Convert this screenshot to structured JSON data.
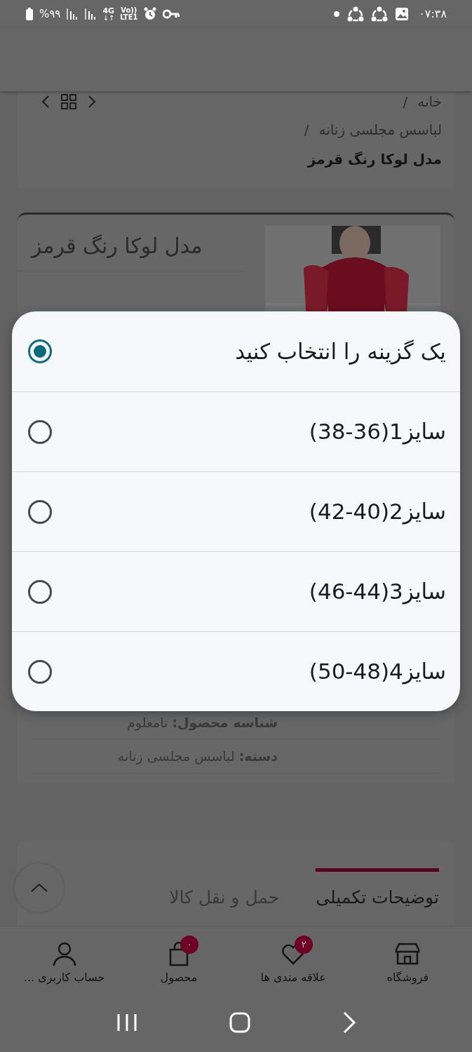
{
  "status_bar": {
    "time": "۰۷:۳۸",
    "battery": "%۹۹",
    "network": "4G",
    "data_arrows": "↓↑",
    "volte": "Vo))",
    "lte": "LTE1"
  },
  "breadcrumb": {
    "items": [
      "خانه",
      "لباسس مجلسی زنانه"
    ],
    "separators": [
      "/",
      "/"
    ],
    "current": "مدل لوکا رنگ قرمز"
  },
  "product": {
    "title": "مدل لوکا رنگ قرمز"
  },
  "dialog": {
    "options": [
      {
        "label": "یک گزینه را انتخاب کنید",
        "selected": true
      },
      {
        "label": "سایز1(36-38)",
        "selected": false
      },
      {
        "label": "سایز2(40-42)",
        "selected": false
      },
      {
        "label": "سایز3(44-46)",
        "selected": false
      },
      {
        "label": "سایز4(48-50)",
        "selected": false
      }
    ]
  },
  "details": [
    {
      "text": "**شناسه محصول:** نامعلوم"
    },
    {
      "text": "**دسته:** لباسس مجلسی زنانه"
    }
  ],
  "tabs": [
    {
      "label": "توضیحات تکمیلی",
      "selected": true
    },
    {
      "label": "حمل و نقل کالا",
      "selected": false
    }
  ],
  "bottom_nav": [
    {
      "kind": "store",
      "label": "فروشگاه"
    },
    {
      "kind": "heart",
      "label": "علاقه مندی ها",
      "badge": "۲"
    },
    {
      "kind": "bag",
      "label": "محصول",
      "badge": "۰"
    },
    {
      "kind": "user",
      "label": "حساب کاربری ..."
    }
  ]
}
